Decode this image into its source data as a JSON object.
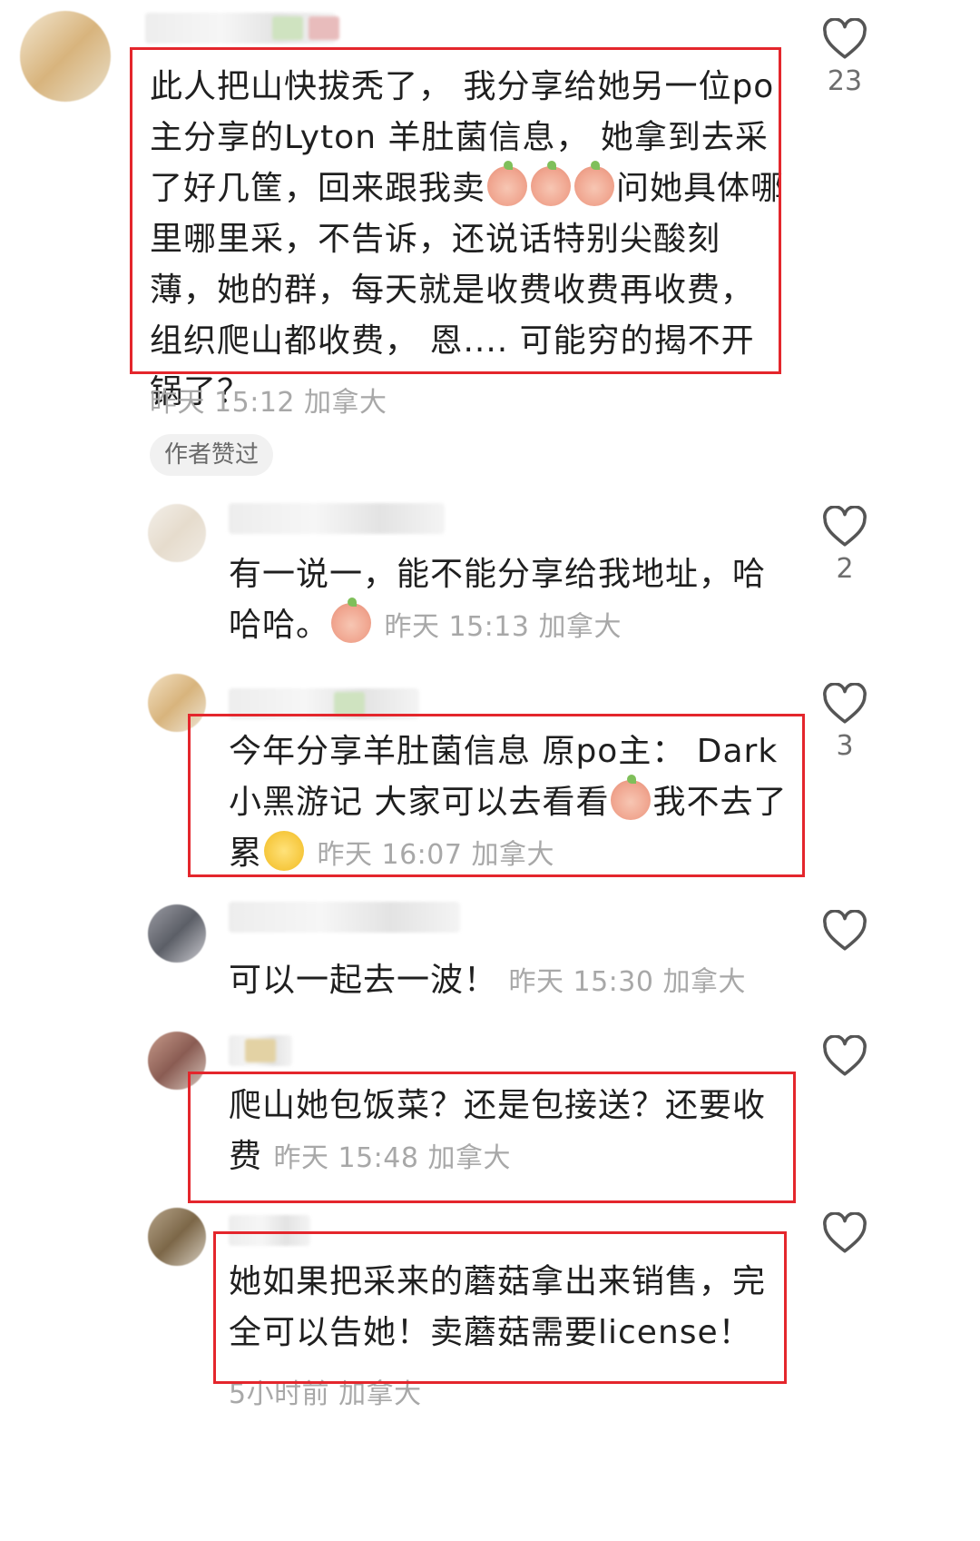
{
  "comments": [
    {
      "text_parts": [
        "此人把山快拔秃了， 我分享给她另一位po主分享的Lyton 羊肚菌信息， 她拿到去采了好几筐，回来跟我卖",
        "问她具体哪里哪里采，不告诉，还说话特别尖酸刻薄，她的群，每天就是收费收费再收费，组织爬山都收费， 恩.... 可能穷的揭不开锅了？"
      ],
      "meta": "昨天 15:12 加拿大",
      "badge": "作者赞过",
      "likes": "23",
      "emoji": "crying-face-emoji"
    },
    {
      "text": "有一说一，能不能分享给我地址，哈哈哈。",
      "meta": "昨天 15:13 加拿大",
      "likes": "2",
      "emoji": "laughing-face-emoji"
    },
    {
      "text_parts": [
        "今年分享羊肚菌信息 原po主： Dark 小黑游记  大家可以去看看",
        "我不去了  累"
      ],
      "meta": "昨天 16:07 加拿大",
      "likes": "3",
      "emoji": "kiss-face-emoji"
    },
    {
      "text": "可以一起去一波！",
      "meta": "昨天 15:30 加拿大",
      "likes": ""
    },
    {
      "text": "爬山她包饭菜？还是包接送？还要收费",
      "meta": "昨天 15:48 加拿大",
      "likes": ""
    },
    {
      "text": "她如果把采来的蘑菇拿出来销售，完全可以告她！卖蘑菇需要license！",
      "meta": "5小时前 加拿大",
      "likes": ""
    }
  ],
  "colors": {
    "highlight": "#e4262c",
    "meta": "#a8a8a8",
    "text": "#1f1f1f"
  }
}
